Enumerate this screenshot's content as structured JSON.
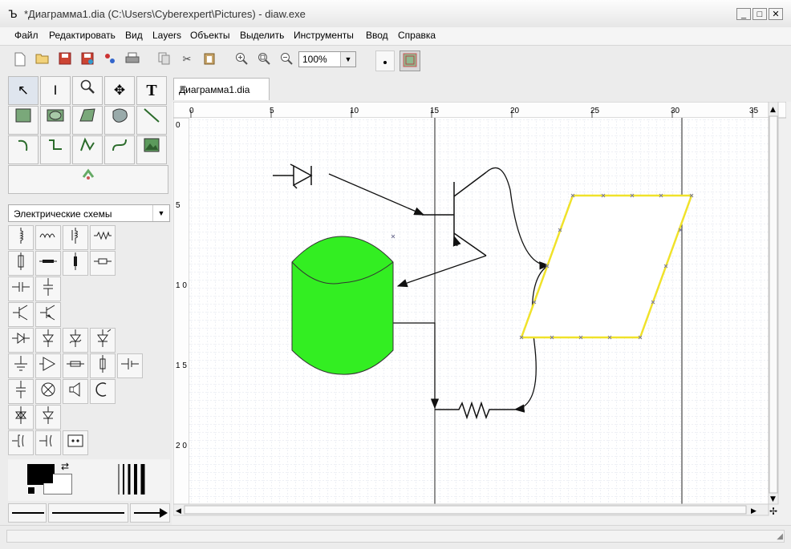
{
  "window": {
    "title": "*Диаграмма1.dia (C:\\Users\\Cyberexpert\\Pictures) - diaw.exe",
    "min_label": "_",
    "max_label": "□",
    "close_label": "✕"
  },
  "menu": [
    "Файл",
    "Редактировать",
    "Вид",
    "Layers",
    "Объекты",
    "Выделить",
    "Инструменты",
    "Ввод",
    "Справка"
  ],
  "toolbar": {
    "zoom_value": "100%"
  },
  "tools": {
    "pointer": "↖",
    "text_cursor": "I",
    "magnify": "🔍",
    "move": "✥",
    "text": "T",
    "box": "▢",
    "ellipse": "◯",
    "polygon": "◇",
    "beziergon": "⬠",
    "line": "╲",
    "arc": "↶",
    "zigzag": "⌐",
    "polyline": "⋀",
    "bezier": "∿",
    "image": "▦",
    "outline": "⇲"
  },
  "sheet": {
    "selected": "Электрические схемы"
  },
  "tab": {
    "label": "Диаграмма1.dia",
    "close": "✖"
  },
  "rulers": {
    "top": [
      "0",
      "5",
      "10",
      "15",
      "20",
      "25",
      "30",
      "35"
    ],
    "left": [
      "0",
      "5",
      "1 0",
      "1 5",
      "2 0"
    ]
  },
  "colors": {
    "fg": "#000000",
    "bg": "#ffffff",
    "cylinder": "#33ee22",
    "parallelogram_stroke": "#f0e22a",
    "grid": "#d8dde8",
    "grid_major": "#b9c1d3"
  }
}
